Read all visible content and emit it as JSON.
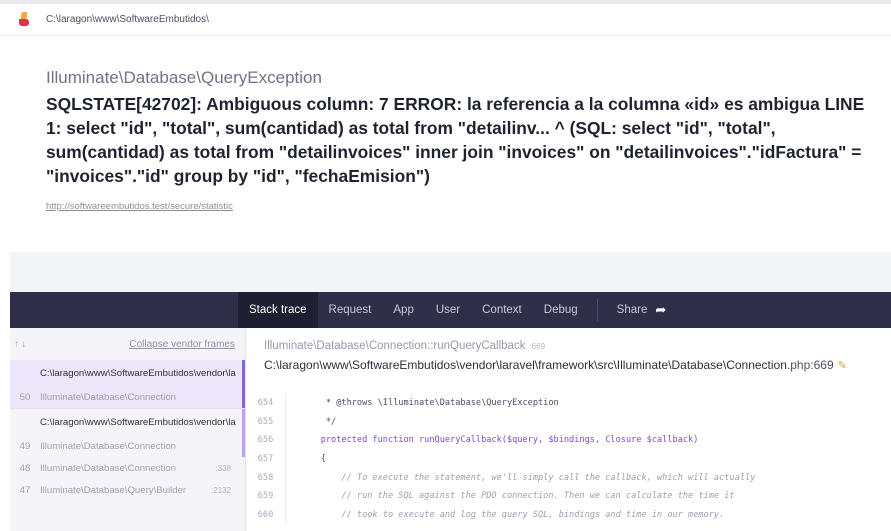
{
  "topbar": {
    "path": "C:\\laragon\\www\\SoftwareEmbutidos\\"
  },
  "exception": {
    "class": "Illuminate\\Database\\QueryException",
    "message": "SQLSTATE[42702]: Ambiguous column: 7 ERROR: la referencia a la columna «id» es ambigua LINE 1: select \"id\", \"total\", sum(cantidad) as total from \"detailinv... ^ (SQL: select \"id\", \"total\", sum(cantidad) as total from \"detailinvoices\" inner join \"invoices\" on \"detailinvoices\".\"idFactura\" = \"invoices\".\"id\" group by \"id\", \"fechaEmision\")",
    "url": "http://softwareembutidos.test/secure/statistic"
  },
  "nav": {
    "tabs": [
      "Stack trace",
      "Request",
      "App",
      "User",
      "Context",
      "Debug"
    ],
    "share": "Share"
  },
  "sidebar": {
    "arrows": "↑↓",
    "collapse": "Collapse vendor frames",
    "groups": [
      {
        "path": "C:\\laragon\\www\\SoftwareEmbutidos\\vendor\\la",
        "frames": [
          {
            "num": "50",
            "cls": "Illuminate\\Database\\Connection",
            "line": ""
          }
        ]
      },
      {
        "path": "C:\\laragon\\www\\SoftwareEmbutidos\\vendor\\la",
        "frames": [
          {
            "num": "49",
            "cls": "Illuminate\\Database\\Connection",
            "line": ""
          },
          {
            "num": "48",
            "cls": "Illuminate\\Database\\Connection",
            "line": ":338"
          },
          {
            "num": "47",
            "cls": "Illuminate\\Database\\Query\\Builder",
            "line": ":2132"
          }
        ]
      }
    ]
  },
  "main": {
    "crumb": "Illuminate\\Database\\Connection::runQueryCallback",
    "crumb_line": ":669",
    "file": "C:\\laragon\\www\\SoftwareEmbutidos\\vendor\\laravel\\framework\\src\\Illuminate\\Database\\Connection",
    "file_ext": ".php:669",
    "code": [
      {
        "n": "654",
        "t": "     * @throws \\Illuminate\\Database\\QueryException",
        "k": "normal"
      },
      {
        "n": "655",
        "t": "     */",
        "k": "normal"
      },
      {
        "n": "656",
        "t": "    protected function runQueryCallback($query, $bindings, Closure $callback)",
        "k": "kw"
      },
      {
        "n": "657",
        "t": "    {",
        "k": "normal"
      },
      {
        "n": "658",
        "t": "        // To execute the statement, we'll simply call the callback, which will actually",
        "k": "comment"
      },
      {
        "n": "659",
        "t": "        // run the SQL against the PDO connection. Then we can calculate the time it",
        "k": "comment"
      },
      {
        "n": "660",
        "t": "        // took to execute and log the query SQL, bindings and time in our memory.",
        "k": "comment"
      }
    ]
  }
}
